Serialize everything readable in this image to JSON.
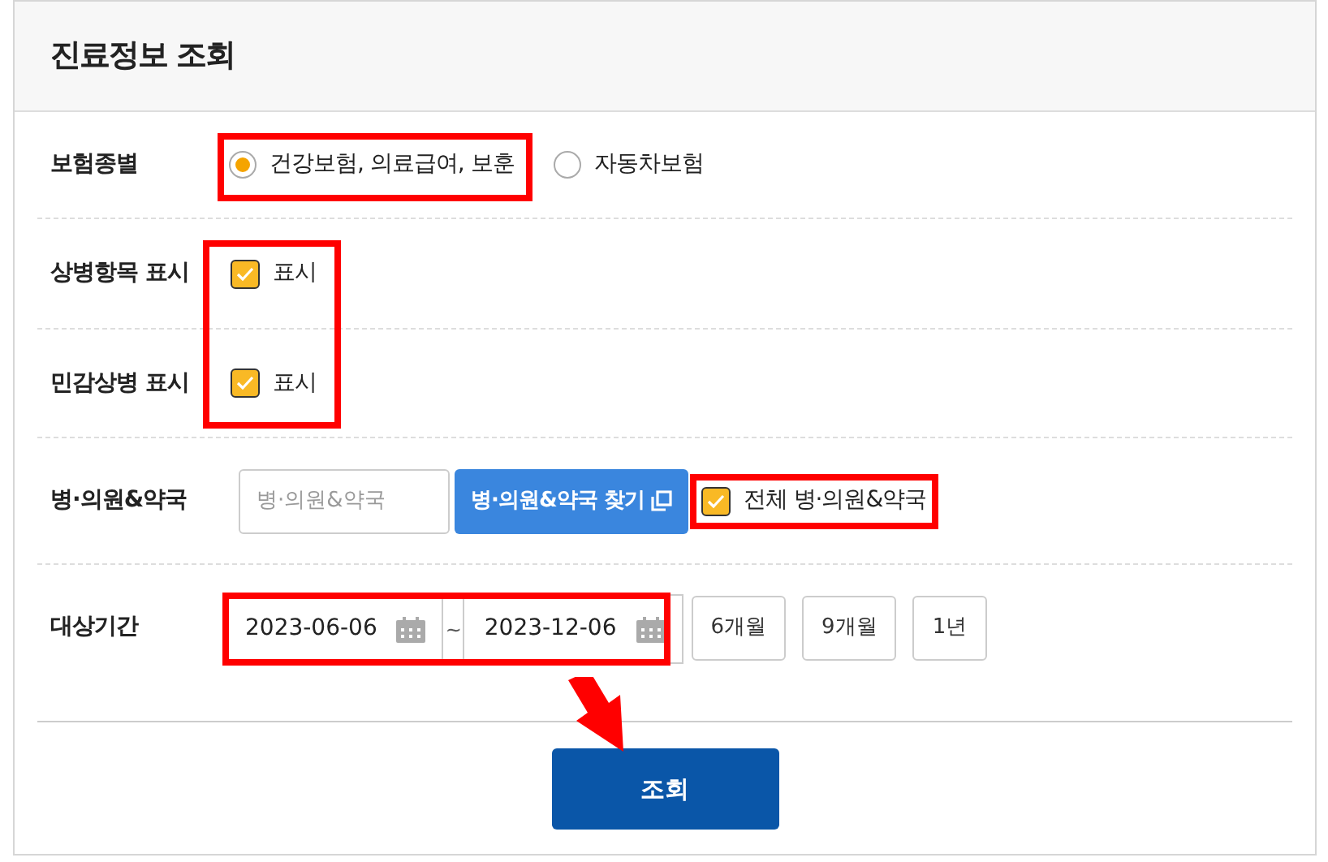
{
  "title": "진료정보 조회",
  "rows": [
    {
      "kind": "radio",
      "label": "보험종별",
      "options": [
        {
          "label": "건강보험, 의료급여, 보훈",
          "selected": true
        },
        {
          "label": "자동차보험",
          "selected": false
        }
      ]
    },
    {
      "kind": "checkbox",
      "label": "상병항목 표시",
      "option": {
        "label": "표시",
        "checked": true
      }
    },
    {
      "kind": "checkbox",
      "label": "민감상병 표시",
      "option": {
        "label": "표시",
        "checked": true
      }
    },
    {
      "kind": "hospital",
      "label": "병·의원&약국",
      "field": {
        "placeholder": "병·의원&약국"
      },
      "button": "병·의원&약국 찾기",
      "option": {
        "label": "전체 병·의원&약국",
        "checked": true
      }
    },
    {
      "kind": "period",
      "label": "대상기간",
      "from": "2023-06-06",
      "separator": "~",
      "to": "2023-12-06",
      "presets": [
        "6개월",
        "9개월",
        "1년"
      ]
    }
  ],
  "submit": "조회",
  "annotations": [
    {
      "kind": "box"
    },
    {
      "kind": "box"
    },
    {
      "kind": "box"
    },
    {
      "kind": "box"
    },
    {
      "kind": "arrow"
    }
  ]
}
